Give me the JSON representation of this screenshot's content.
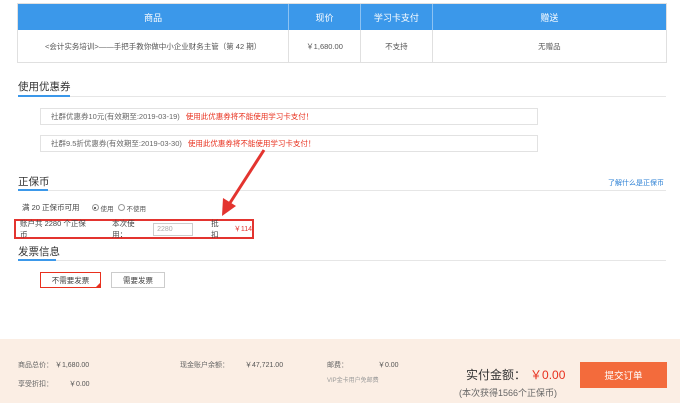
{
  "table": {
    "headers": [
      "商品",
      "现价",
      "学习卡支付",
      "赠送"
    ],
    "row": {
      "product": "<会计实务培训>——手把手教你做中小企业财务主管（第 42 期）",
      "price": "￥1,680.00",
      "card_pay": "不支持",
      "gift": "无赠品"
    }
  },
  "coupons": {
    "title": "使用优惠券",
    "items": [
      {
        "text": "社群优惠券10元(有效期至:2019-03-19)",
        "warning": "使用此优惠券将不能使用学习卡支付！"
      },
      {
        "text": "社群9.5折优惠券(有效期至:2019-03-30)",
        "warning": "使用此优惠券将不能使用学习卡支付！"
      }
    ]
  },
  "coin": {
    "title": "正保币",
    "learn_link": "了解什么是正保币",
    "rule": "满 20 正保币可用",
    "use_label": "使用",
    "nouse_label": "不使用",
    "account_text": "账户共 2280 个正保币",
    "this_use_label": "本次使用：",
    "input_value": "2280",
    "deduct_label": "抵扣",
    "deduct_amount": "￥114"
  },
  "invoice": {
    "title": "发票信息",
    "no_invoice": "不需要发票",
    "need_invoice": "需要发票"
  },
  "footer": {
    "total_label": "商品总价：",
    "total_value": "￥1,680.00",
    "discount_label": "享受折扣：",
    "discount_value": "￥0.00",
    "balance_label": "现金账户余额：",
    "balance_value": "￥47,721.00",
    "postage_label": "邮费：",
    "postage_value": "￥0.00",
    "vip_note": "VIP金卡用户免邮费",
    "pay_label": "实付金额：",
    "pay_amount": "￥0.00",
    "pay_note": "(本次获得1566个正保币)",
    "submit": "提交订单"
  },
  "colors": {
    "accent_blue": "#3b98ea",
    "warn_red": "#e8301e",
    "submit_orange": "#f36b3c",
    "footer_bg": "#fbeee4"
  }
}
